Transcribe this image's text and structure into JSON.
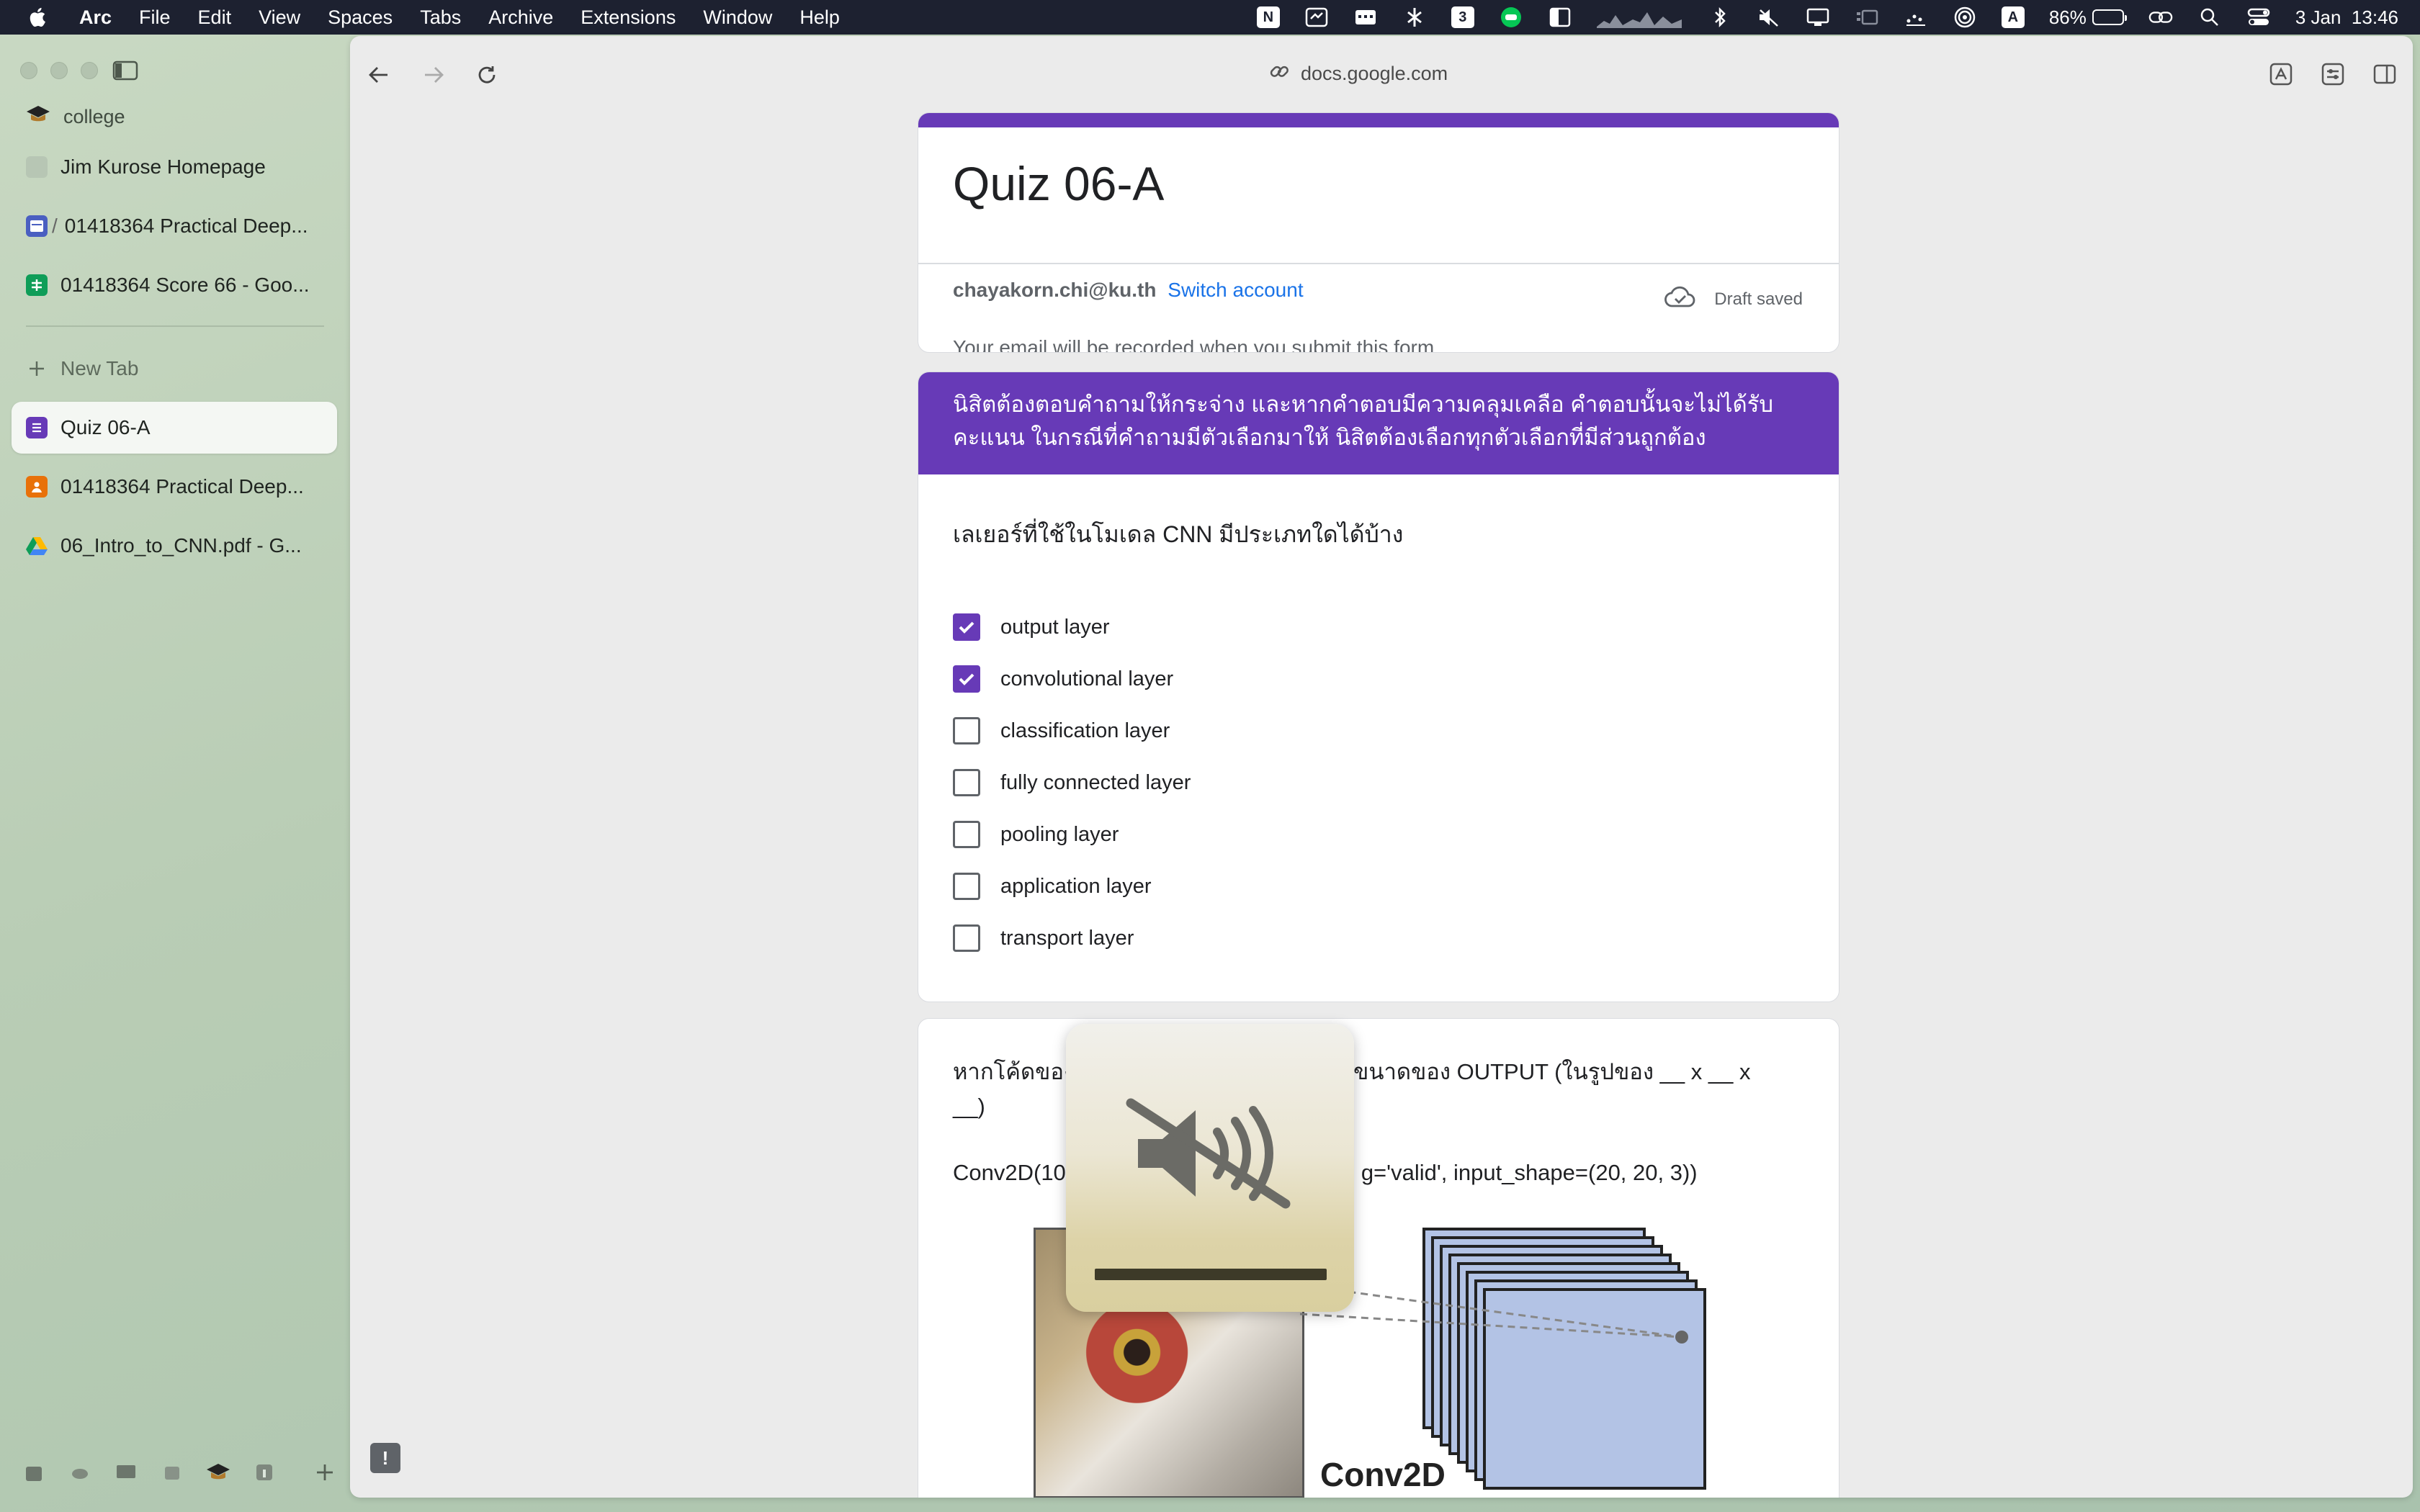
{
  "menubar": {
    "app": "Arc",
    "items": [
      "File",
      "Edit",
      "View",
      "Spaces",
      "Tabs",
      "Archive",
      "Extensions",
      "Window",
      "Help"
    ],
    "status": {
      "badge_n": "N",
      "badge_three": "3",
      "badge_a": "A",
      "battery_percent": "86%",
      "battery_level": 0.86,
      "datetime": "3 Jan  13:46"
    }
  },
  "sidebar": {
    "space_name": "college",
    "pinned": [
      {
        "label": "Jim Kurose Homepage",
        "icon": "gray-square-icon"
      },
      {
        "label": "01418364 Practical Deep...",
        "icon": "calendar-icon",
        "prefix": "/"
      },
      {
        "label": "01418364 Score 66 - Goo...",
        "icon": "sheets-icon"
      }
    ],
    "new_tab_label": "New Tab",
    "tabs": [
      {
        "label": "Quiz 06-A",
        "icon": "forms-icon",
        "active": true
      },
      {
        "label": "01418364 Practical Deep...",
        "icon": "classroom-icon",
        "active": false
      },
      {
        "label": "06_Intro_to_CNN.pdf - G...",
        "icon": "drive-icon",
        "active": false
      }
    ]
  },
  "browser": {
    "url": "docs.google.com"
  },
  "form": {
    "title": "Quiz 06-A",
    "email": "chayakorn.chi@ku.th",
    "switch_account": "Switch account",
    "draft_status": "Draft saved",
    "record_note": "Your email will be recorded when you submit this form",
    "instructions_line1": "นิสิตต้องตอบคำถามให้กระจ่าง และหากคำตอบมีความคลุมเคลือ คำตอบนั้นจะไม่ได้รับ",
    "instructions_line2": "คะแนน  ในกรณีที่คำถามมีตัวเลือกมาให้ นิสิตต้องเลือกทุกตัวเลือกที่มีส่วนถูกต้อง",
    "question1": {
      "text": "เลเยอร์ที่ใช้ในโมเดล CNN มีประเภทใดได้บ้าง",
      "options": [
        {
          "label": "output layer",
          "checked": true
        },
        {
          "label": "convolutional layer",
          "checked": true
        },
        {
          "label": "classification layer",
          "checked": false
        },
        {
          "label": "fully connected layer",
          "checked": false
        },
        {
          "label": "pooling layer",
          "checked": false
        },
        {
          "label": "application layer",
          "checked": false
        },
        {
          "label": "transport layer",
          "checked": false
        }
      ]
    },
    "question2": {
      "text_before": "หากโค้ดของ",
      "text_after": "บอกขนาดของ OUTPUT (ในรูปของ __ x __ x",
      "text_line2": "__)",
      "code_before": "Conv2D(10",
      "code_after": "g='valid', input_shape=(20, 20, 3))",
      "figure_label": "Conv2D"
    }
  },
  "overlay": {
    "volume_state": "muted",
    "volume_level": 0
  },
  "colors": {
    "forms_purple": "#673ab7",
    "link_blue": "#1a73e8",
    "menubar_bg": "#1d2130"
  }
}
